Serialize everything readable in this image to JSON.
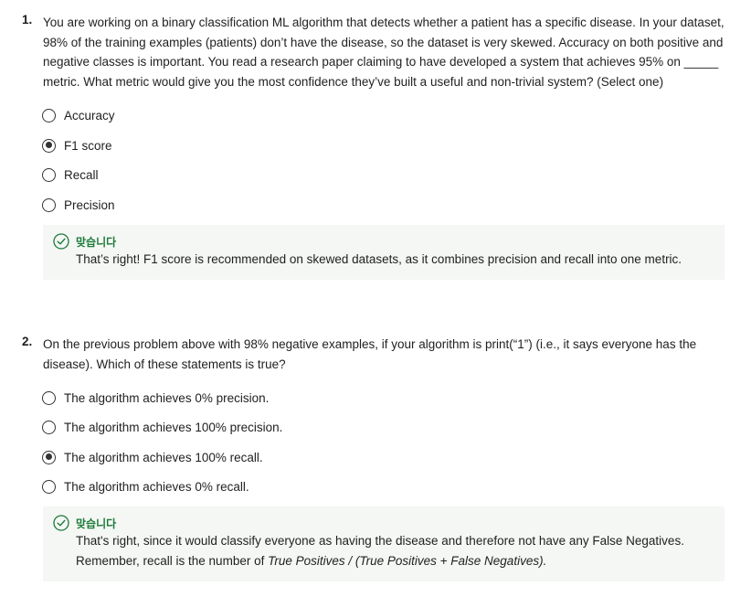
{
  "questions": [
    {
      "number": "1.",
      "lines": [
        "You are working on a binary classification ML algorithm that detects whether a patient has a specific disease. In your dataset,",
        "98% of the training examples (patients) don’t have the disease, so the dataset is very skewed. Accuracy on both positive and",
        "negative classes is important. You read a research paper claiming to have developed a system that achieves 95% on _____",
        "metric. What metric would give you the most confidence they’ve built a useful and non-trivial system? (Select one)"
      ],
      "options": [
        {
          "label": "Accuracy",
          "selected": false
        },
        {
          "label": "F1 score",
          "selected": true
        },
        {
          "label": "Recall",
          "selected": false
        },
        {
          "label": "Precision",
          "selected": false
        }
      ],
      "feedback": {
        "title": "맞습니다",
        "line1": "That’s right! F1 score is recommended on skewed datasets, as it combines precision and recall into one metric."
      }
    },
    {
      "number": "2.",
      "lines": [
        "On the previous problem above with 98% negative examples, if your algorithm is print(“1”) (i.e., it says everyone has the",
        "disease). Which of these statements is true?"
      ],
      "options": [
        {
          "label": "The algorithm achieves 0% precision.",
          "selected": false
        },
        {
          "label": "The algorithm achieves 100% precision.",
          "selected": false
        },
        {
          "label": "The algorithm achieves 100% recall.",
          "selected": true
        },
        {
          "label": "The algorithm achieves 0% recall.",
          "selected": false
        }
      ],
      "feedback": {
        "title": "맞습니다",
        "line1": "That's right, since it would classify everyone as having the disease and therefore not have any False Negatives.",
        "line2_prefix": "Remember, recall is the number of ",
        "line2_formula": "True Positives / (True Positives + False Negatives)."
      }
    }
  ],
  "colors": {
    "correct": "#1d7a3a",
    "feedback_bg": "#f4f7f4"
  }
}
